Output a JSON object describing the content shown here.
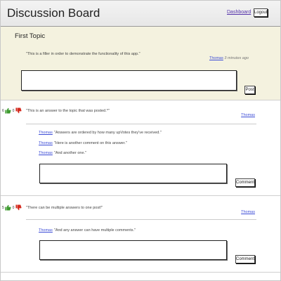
{
  "header": {
    "title": "Discussion Board",
    "dashboard_link": "Dashboard",
    "logout_label": "Logout"
  },
  "topic": {
    "title": "First Topic",
    "body": "\"This is a filler in order to demonstrate the functionality of this app.\"",
    "author": "Thomas",
    "time": "3 minutes ago",
    "post_label": "Post"
  },
  "answers": [
    {
      "upvotes": "6",
      "downvotes": "0",
      "text": "\"This is an answer to the topic that was posted.*\"",
      "author": "Thomas",
      "comments": [
        {
          "author": "Thomas",
          "text": "\"Answers are ordered by how many upVotes they've received.\""
        },
        {
          "author": "Thomas",
          "text": "\"Here is another comment on this answer.\""
        },
        {
          "author": "Thomas",
          "text": "\"And another one.\""
        }
      ],
      "comment_label": "Comment"
    },
    {
      "upvotes": "5",
      "downvotes": "0",
      "text": "\"There can be multiple answers to one post!\"",
      "author": "Thomas",
      "comments": [
        {
          "author": "Thomas",
          "text": "\"And any answer can have multiple comments.\""
        }
      ],
      "comment_label": "Comment"
    }
  ],
  "colors": {
    "header_bg": "#ececec",
    "topic_bg": "#f4f2df",
    "link": "#3b4bd6",
    "thumb_up": "#3c9a2e",
    "thumb_down": "#d42a1e"
  }
}
